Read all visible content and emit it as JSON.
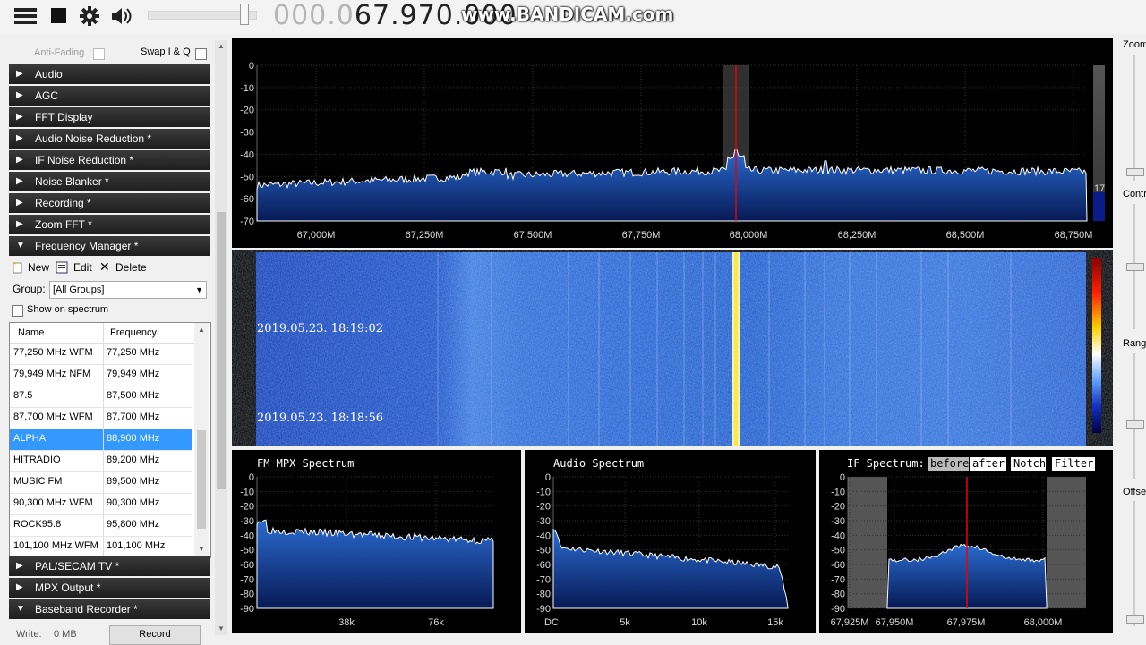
{
  "toolbar": {
    "icons": [
      "menu-icon",
      "stop-icon",
      "gear-icon",
      "speaker-icon"
    ],
    "frequency_dim": "000.0",
    "frequency_lit": "67.970.000",
    "watermark": "www.BANDICAM.com"
  },
  "sidebar": {
    "anti_fading": "Anti-Fading",
    "swap_iq": "Swap I & Q",
    "panels": [
      {
        "label": "Audio",
        "expanded": false
      },
      {
        "label": "AGC",
        "expanded": false
      },
      {
        "label": "FFT Display",
        "expanded": false
      },
      {
        "label": "Audio Noise Reduction *",
        "expanded": false
      },
      {
        "label": "IF Noise Reduction *",
        "expanded": false
      },
      {
        "label": "Noise Blanker *",
        "expanded": false
      },
      {
        "label": "Recording *",
        "expanded": false
      },
      {
        "label": "Zoom FFT *",
        "expanded": false
      },
      {
        "label": "Frequency Manager *",
        "expanded": true
      }
    ],
    "freq_manager": {
      "new": "New",
      "edit": "Edit",
      "delete": "Delete",
      "group_label": "Group:",
      "group_value": "[All Groups]",
      "show_on_spectrum": "Show on spectrum",
      "col_name": "Name",
      "col_freq": "Frequency",
      "rows": [
        {
          "name": "77,250 MHz WFM",
          "freq": "77,250 MHz"
        },
        {
          "name": "79,949 MHz NFM",
          "freq": "79,949 MHz"
        },
        {
          "name": "87.5",
          "freq": "87,500 MHz"
        },
        {
          "name": "87,700 MHz WFM",
          "freq": "87,700 MHz"
        },
        {
          "name": "ALPHA",
          "freq": "88,900 MHz",
          "selected": true
        },
        {
          "name": "HITRADIO",
          "freq": "89,200 MHz"
        },
        {
          "name": "MUSIC FM",
          "freq": "89,500 MHz"
        },
        {
          "name": "90,300 MHz WFM",
          "freq": "90,300 MHz"
        },
        {
          "name": "ROCK95.8",
          "freq": "95,800 MHz"
        },
        {
          "name": "101,100 MHz WFM",
          "freq": "101,100 MHz"
        }
      ]
    },
    "panels_after": [
      {
        "label": "PAL/SECAM TV *",
        "expanded": false
      },
      {
        "label": "MPX Output *",
        "expanded": false
      },
      {
        "label": "Baseband Recorder *",
        "expanded": true
      }
    ],
    "recorder": {
      "write_label": "Write:",
      "write_value": "0 MB",
      "record": "Record"
    }
  },
  "main_spectrum": {
    "y_ticks": [
      "0",
      "-10",
      "-20",
      "-30",
      "-40",
      "-50",
      "-60",
      "-70"
    ],
    "x_ticks": [
      "67,000M",
      "67,250M",
      "67,500M",
      "67,750M",
      "68,000M",
      "68,250M",
      "68,500M",
      "68,750M"
    ],
    "level_label": "17"
  },
  "waterfall": {
    "timestamps": [
      "2019.05.23. 18:19:02",
      "2019.05.23. 18:18:56"
    ]
  },
  "mpx": {
    "title": "FM MPX Spectrum",
    "y_ticks": [
      "0",
      "-10",
      "-20",
      "-30",
      "-40",
      "-50",
      "-60",
      "-70",
      "-80",
      "-90"
    ],
    "x_ticks": [
      "38k",
      "76k"
    ]
  },
  "audio": {
    "title": "Audio Spectrum",
    "y_ticks": [
      "0",
      "-10",
      "-20",
      "-30",
      "-40",
      "-50",
      "-60",
      "-70",
      "-80",
      "-90"
    ],
    "x_ticks": [
      "DC",
      "5k",
      "10k",
      "15k"
    ]
  },
  "ifspec": {
    "title": "IF Spectrum:",
    "buttons": [
      "before",
      "after",
      "Notch",
      "Filter"
    ],
    "y_ticks": [
      "0",
      "-10",
      "-20",
      "-30",
      "-40",
      "-50",
      "-60",
      "-70",
      "-80",
      "-90"
    ],
    "x_ticks": [
      "67,925M",
      "67,950M",
      "67,975M",
      "68,000M"
    ]
  },
  "rightbar": {
    "zoom": "Zoom",
    "contrast": "Contra",
    "range": "Range",
    "offset": "Offse"
  }
}
